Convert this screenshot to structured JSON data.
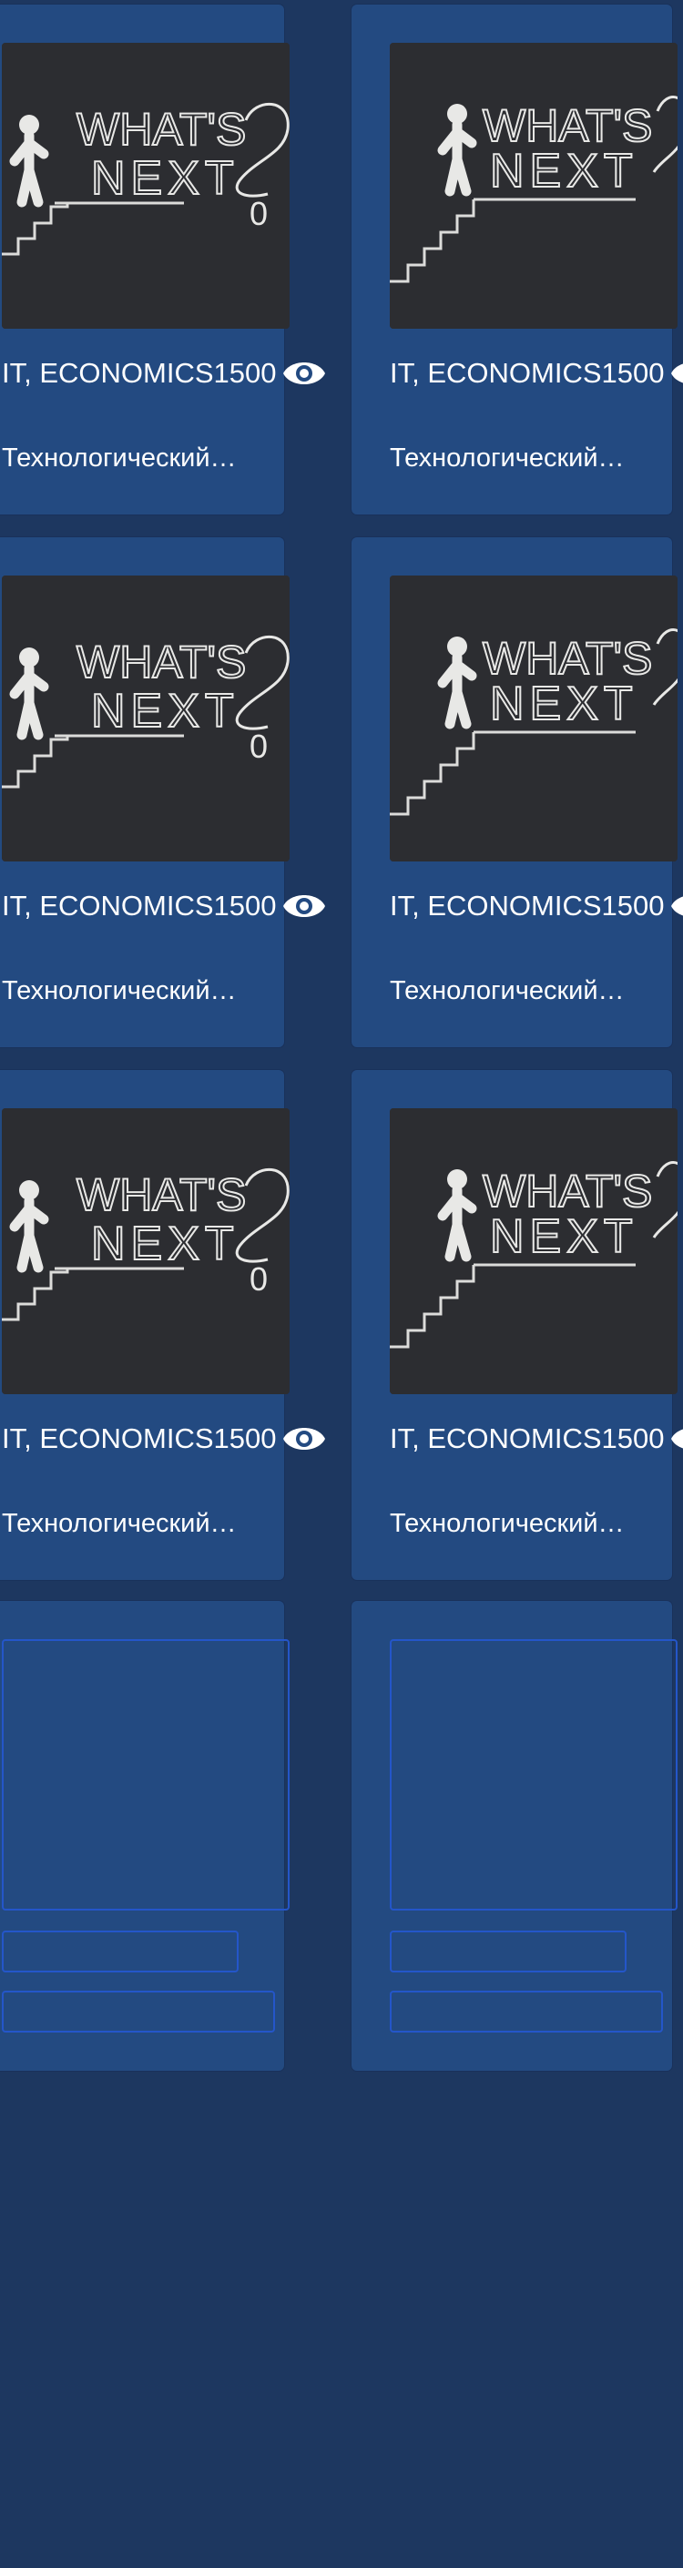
{
  "cards": [
    {
      "category": "IT, ECONOMICS1500",
      "title": "Технологический…",
      "eye_icon": "eye-icon"
    },
    {
      "category": "IT, ECONOMICS1500",
      "title": "Технологический…",
      "eye_icon": "eye-icon"
    },
    {
      "category": "IT, ECONOMICS1500",
      "title": "Технологический…",
      "eye_icon": "eye-icon"
    },
    {
      "category": "IT, ECONOMICS1500",
      "title": "Технологический…",
      "eye_icon": "eye-icon"
    },
    {
      "category": "IT, ECONOMICS1500",
      "title": "Технологический…",
      "eye_icon": "eye-icon"
    },
    {
      "category": "IT, ECONOMICS1500",
      "title": "Технологический…",
      "eye_icon": "eye-icon"
    }
  ],
  "thumbnail": {
    "line1": "WHAT'S",
    "line2": "NEXT",
    "digit": "0"
  },
  "colors": {
    "page_background": "#1d3760",
    "card_background": "#234a81",
    "skeleton_border": "#2456c9",
    "text": "#ffffff"
  }
}
